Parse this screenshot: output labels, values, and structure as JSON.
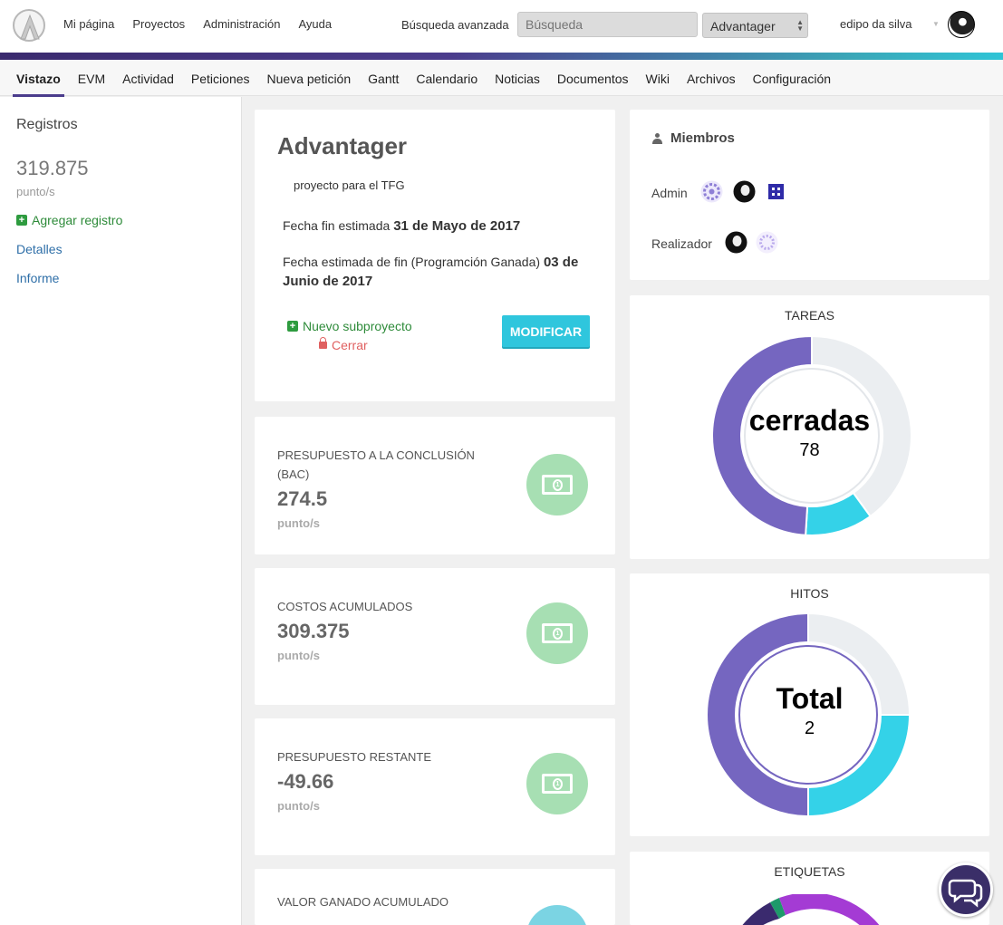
{
  "topnav": {
    "items": [
      "Mi página",
      "Proyectos",
      "Administración",
      "Ayuda"
    ],
    "advanced_search": "Búsqueda avanzada",
    "search_placeholder": "Búsqueda",
    "project_select": "Advantager",
    "username": "edipo da silva"
  },
  "subnav": {
    "tabs": [
      "Vistazo",
      "EVM",
      "Actividad",
      "Peticiones",
      "Nueva petición",
      "Gantt",
      "Calendario",
      "Noticias",
      "Documentos",
      "Wiki",
      "Archivos",
      "Configuración"
    ],
    "active": "Vistazo"
  },
  "sidebar": {
    "title": "Registros",
    "value": "319.875",
    "unit": "punto/s",
    "add_label": "Agregar registro",
    "details_label": "Detalles",
    "report_label": "Informe"
  },
  "project": {
    "title": "Advantager",
    "description": "proyecto para el TFG",
    "end_label": "Fecha fin estimada",
    "end_value": "31 de Mayo de 2017",
    "evm_end_label": "Fecha estimada de fin (Programción Ganada)",
    "evm_end_value": "03 de Junio de 2017",
    "new_sub_label": "Nuevo subproyecto",
    "close_label": "Cerrar",
    "modify_label": "MODIFICAR"
  },
  "metrics": [
    {
      "label": "PRESUPUESTO A LA CONCLUSIÓN (BAC)",
      "value": "274.5",
      "unit": "punto/s"
    },
    {
      "label": "COSTOS ACUMULADOS",
      "value": "309.375",
      "unit": "punto/s"
    },
    {
      "label": "PRESUPUESTO RESTANTE",
      "value": "-49.66",
      "unit": "punto/s"
    },
    {
      "label": "VALOR GANADO ACUMULADO",
      "value": "",
      "unit": ""
    }
  ],
  "members": {
    "title": "Miembros",
    "roles": [
      {
        "name": "Admin",
        "avatars": 3
      },
      {
        "name": "Realizador",
        "avatars": 2
      }
    ]
  },
  "colors": {
    "purple": "#7566c0",
    "cyan": "#34d2e8",
    "gray": "#ebeef1",
    "green_icon": "#a7dfb3",
    "header_gradient_start": "#3a2a6e",
    "header_gradient_end": "#2fc4d6"
  },
  "chart_data": [
    {
      "type": "pie",
      "title": "TAREAS",
      "center_label": "cerradas",
      "center_value": "78",
      "slices": [
        {
          "value": 49,
          "color": "#7566c0"
        },
        {
          "value": 11,
          "color": "#34d2e8"
        },
        {
          "value": 40,
          "color": "#ebeef1"
        }
      ]
    },
    {
      "type": "pie",
      "title": "HITOS",
      "center_label": "Total",
      "center_value": "2",
      "slices": [
        {
          "value": 50,
          "color": "#7566c0"
        },
        {
          "value": 25,
          "color": "#34d2e8"
        },
        {
          "value": 25,
          "color": "#ebeef1"
        }
      ]
    },
    {
      "type": "pie",
      "title": "ETIQUETAS",
      "slices": []
    }
  ]
}
